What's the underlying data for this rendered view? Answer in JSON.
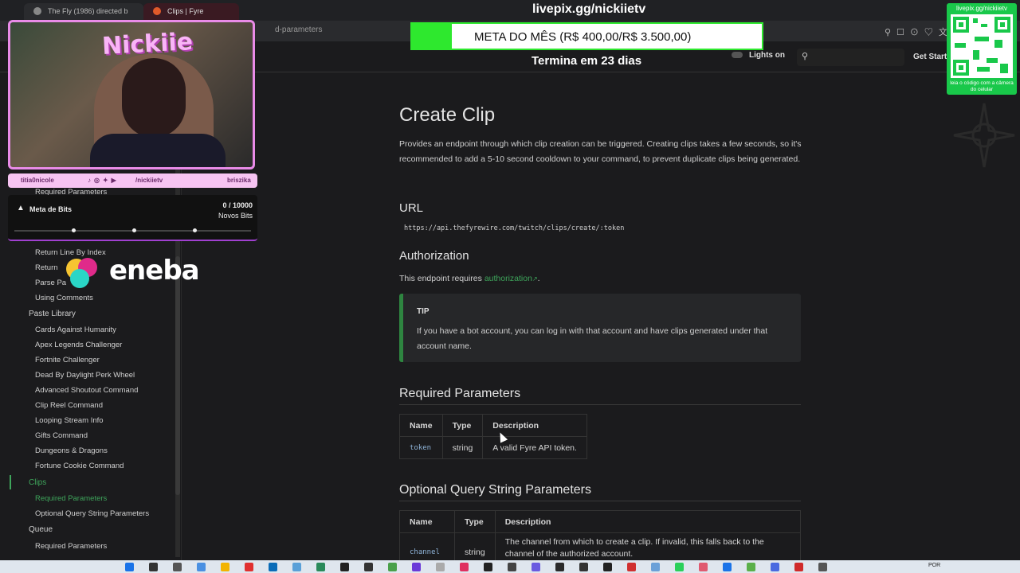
{
  "browser": {
    "tabs": [
      {
        "label": "The Fly (1986) directed b"
      },
      {
        "label": "Clips | Fyre"
      }
    ],
    "address": "d-parameters"
  },
  "site_header": {
    "lights_label": "Lights on",
    "get_started_label": "Get Starte"
  },
  "sidebar": {
    "items": [
      {
        "label": "Required Parameters",
        "level": "sub",
        "state": "partial"
      },
      {
        "label": "Return Line By Index",
        "level": "sub"
      },
      {
        "label": "Return",
        "level": "sub"
      },
      {
        "label": "Parse Pa",
        "level": "sub"
      },
      {
        "label": "Using Comments",
        "level": "sub"
      },
      {
        "label": "Paste Library",
        "level": "top"
      },
      {
        "label": "Cards Against Humanity",
        "level": "sub"
      },
      {
        "label": "Apex Legends Challenger",
        "level": "sub"
      },
      {
        "label": "Fortnite Challenger",
        "level": "sub"
      },
      {
        "label": "Dead By Daylight Perk Wheel",
        "level": "sub"
      },
      {
        "label": "Advanced Shoutout Command",
        "level": "sub"
      },
      {
        "label": "Clip Reel Command",
        "level": "sub"
      },
      {
        "label": "Looping Stream Info",
        "level": "sub"
      },
      {
        "label": "Gifts Command",
        "level": "sub"
      },
      {
        "label": "Dungeons & Dragons",
        "level": "sub"
      },
      {
        "label": "Fortune Cookie Command",
        "level": "sub"
      },
      {
        "label": "Clips",
        "level": "top",
        "active": true
      },
      {
        "label": "Required Parameters",
        "level": "sub",
        "active": true
      },
      {
        "label": "Optional Query String Parameters",
        "level": "sub"
      },
      {
        "label": "Queue",
        "level": "top"
      },
      {
        "label": "Required Parameters",
        "level": "sub"
      }
    ]
  },
  "content": {
    "title": "Create Clip",
    "intro": "Provides an endpoint through which clip creation can be triggered. Creating clips takes a few seconds, so it's recommended to add a 5-10 second cooldown to your command, to prevent duplicate clips being generated.",
    "url_heading": "URL",
    "url": "https://api.thefyrewire.com/twitch/clips/create/:token",
    "auth_heading": "Authorization",
    "auth_prefix": "This endpoint requires ",
    "auth_link": "authorization",
    "auth_suffix": ".",
    "tip_title": "TIP",
    "tip_body": "If you have a bot account, you can log in with that account and have clips generated under that account name.",
    "required_heading": "Required Parameters",
    "required_table": {
      "headers": [
        "Name",
        "Type",
        "Description"
      ],
      "rows": [
        [
          "token",
          "string",
          "A valid Fyre API token."
        ]
      ]
    },
    "optional_heading": "Optional Query String Parameters",
    "optional_table": {
      "headers": [
        "Name",
        "Type",
        "Description"
      ],
      "rows": [
        [
          "channel",
          "string",
          "The channel from which to create a clip. If invalid, this falls back to the channel of the authorized account."
        ]
      ]
    }
  },
  "overlay": {
    "streamer_name": "Nickiie",
    "social_left": "titia0nicole",
    "social_handle": "/nickiietv",
    "social_right": "briszika",
    "bits_label": "Meta de Bits",
    "bits_count": "0 / 10000",
    "bits_unit": "Novos Bits",
    "bits_progress": 0,
    "sponsor": "eneba",
    "meta_url": "livepix.gg/nickiietv",
    "meta_text": "META DO MÊS (R$ 400,00/R$ 3.500,00)",
    "meta_progress": 0.114,
    "meta_sub": "Termina em 23 dias",
    "qr_top": "livepix.gg/nickiietv",
    "qr_bottom": "leia o código com a câmera do celular"
  },
  "taskbar": {
    "lang": "POR"
  },
  "colors": {
    "accent_green": "#3ea55b",
    "overlay_pink": "#e98be8",
    "meta_green": "#2ee82e"
  }
}
